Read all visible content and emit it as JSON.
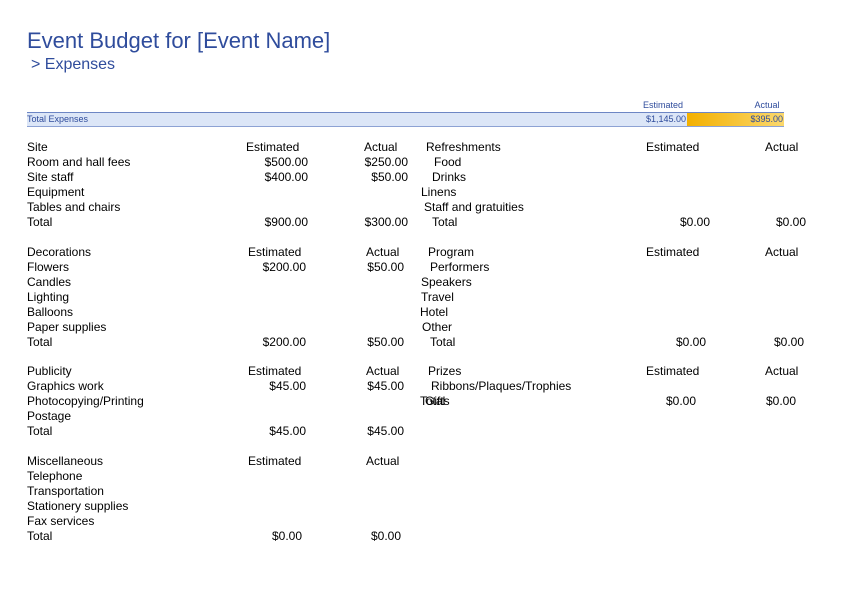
{
  "title": "Event Budget for [Event Name]",
  "subtitle": "> Expenses",
  "headers": {
    "estimated": "Estimated",
    "actual": "Actual"
  },
  "total_expenses": {
    "label": "Total Expenses",
    "estimated": "$1,145.00",
    "actual": "$395.00"
  },
  "colors": {
    "accent": "#2f4c9c",
    "bar": "#dce6f7",
    "highlight": "#f3b000"
  },
  "sections": {
    "site": {
      "title": "Site",
      "estimated_label": "Estimated",
      "actual_label": "Actual",
      "items": [
        {
          "label": "Room and hall fees",
          "estimated": "$500.00",
          "actual": "$250.00"
        },
        {
          "label": "Site staff",
          "estimated": "$400.00",
          "actual": "$50.00"
        },
        {
          "label": "Equipment",
          "estimated": "",
          "actual": ""
        },
        {
          "label": "Tables and chairs",
          "estimated": "",
          "actual": ""
        }
      ],
      "total": {
        "label": "Total",
        "estimated": "$900.00",
        "actual": "$300.00"
      }
    },
    "refreshments": {
      "title": "Refreshments",
      "estimated_label": "Estimated",
      "actual_label": "Actual",
      "items": [
        {
          "label": "Food",
          "estimated": "",
          "actual": ""
        },
        {
          "label": "Drinks",
          "estimated": "",
          "actual": ""
        },
        {
          "label": "Linens",
          "estimated": "",
          "actual": ""
        },
        {
          "label": "Staff and gratuities",
          "estimated": "",
          "actual": ""
        }
      ],
      "total": {
        "label": "Total",
        "estimated": "$0.00",
        "actual": "$0.00"
      }
    },
    "decorations": {
      "title": "Decorations",
      "estimated_label": "Estimated",
      "actual_label": "Actual",
      "items": [
        {
          "label": "Flowers",
          "estimated": "$200.00",
          "actual": "$50.00"
        },
        {
          "label": "Candles",
          "estimated": "",
          "actual": ""
        },
        {
          "label": "Lighting",
          "estimated": "",
          "actual": ""
        },
        {
          "label": "Balloons",
          "estimated": "",
          "actual": ""
        },
        {
          "label": "Paper supplies",
          "estimated": "",
          "actual": ""
        }
      ],
      "total": {
        "label": "Total",
        "estimated": "$200.00",
        "actual": "$50.00"
      }
    },
    "program": {
      "title": "Program",
      "estimated_label": "Estimated",
      "actual_label": "Actual",
      "items": [
        {
          "label": "Performers",
          "estimated": "",
          "actual": ""
        },
        {
          "label": "Speakers",
          "estimated": "",
          "actual": ""
        },
        {
          "label": "Travel",
          "estimated": "",
          "actual": ""
        },
        {
          "label": "Hotel",
          "estimated": "",
          "actual": ""
        },
        {
          "label": "Other",
          "estimated": "",
          "actual": ""
        }
      ],
      "total": {
        "label": "Total",
        "estimated": "$0.00",
        "actual": "$0.00"
      }
    },
    "publicity": {
      "title": "Publicity",
      "estimated_label": "Estimated",
      "actual_label": "Actual",
      "items": [
        {
          "label": "Graphics work",
          "estimated": "$45.00",
          "actual": "$45.00"
        },
        {
          "label": "Photocopying/Printing",
          "estimated": "",
          "actual": ""
        },
        {
          "label": "Postage",
          "estimated": "",
          "actual": ""
        }
      ],
      "total": {
        "label": "Total",
        "estimated": "$45.00",
        "actual": "$45.00"
      }
    },
    "prizes": {
      "title": "Prizes",
      "estimated_label": "Estimated",
      "actual_label": "Actual",
      "items": [
        {
          "label": "Ribbons/Plaques/Trophies",
          "estimated": "",
          "actual": ""
        },
        {
          "label": "Gifts",
          "estimated": "",
          "actual": ""
        }
      ],
      "total": {
        "label": "Total",
        "estimated": "$0.00",
        "actual": "$0.00"
      }
    },
    "misc": {
      "title": "Miscellaneous",
      "estimated_label": "Estimated",
      "actual_label": "Actual",
      "items": [
        {
          "label": "Telephone",
          "estimated": "",
          "actual": ""
        },
        {
          "label": "Transportation",
          "estimated": "",
          "actual": ""
        },
        {
          "label": "Stationery supplies",
          "estimated": "",
          "actual": ""
        },
        {
          "label": "Fax services",
          "estimated": "",
          "actual": ""
        }
      ],
      "total": {
        "label": "Total",
        "estimated": "$0.00",
        "actual": "$0.00"
      }
    }
  }
}
